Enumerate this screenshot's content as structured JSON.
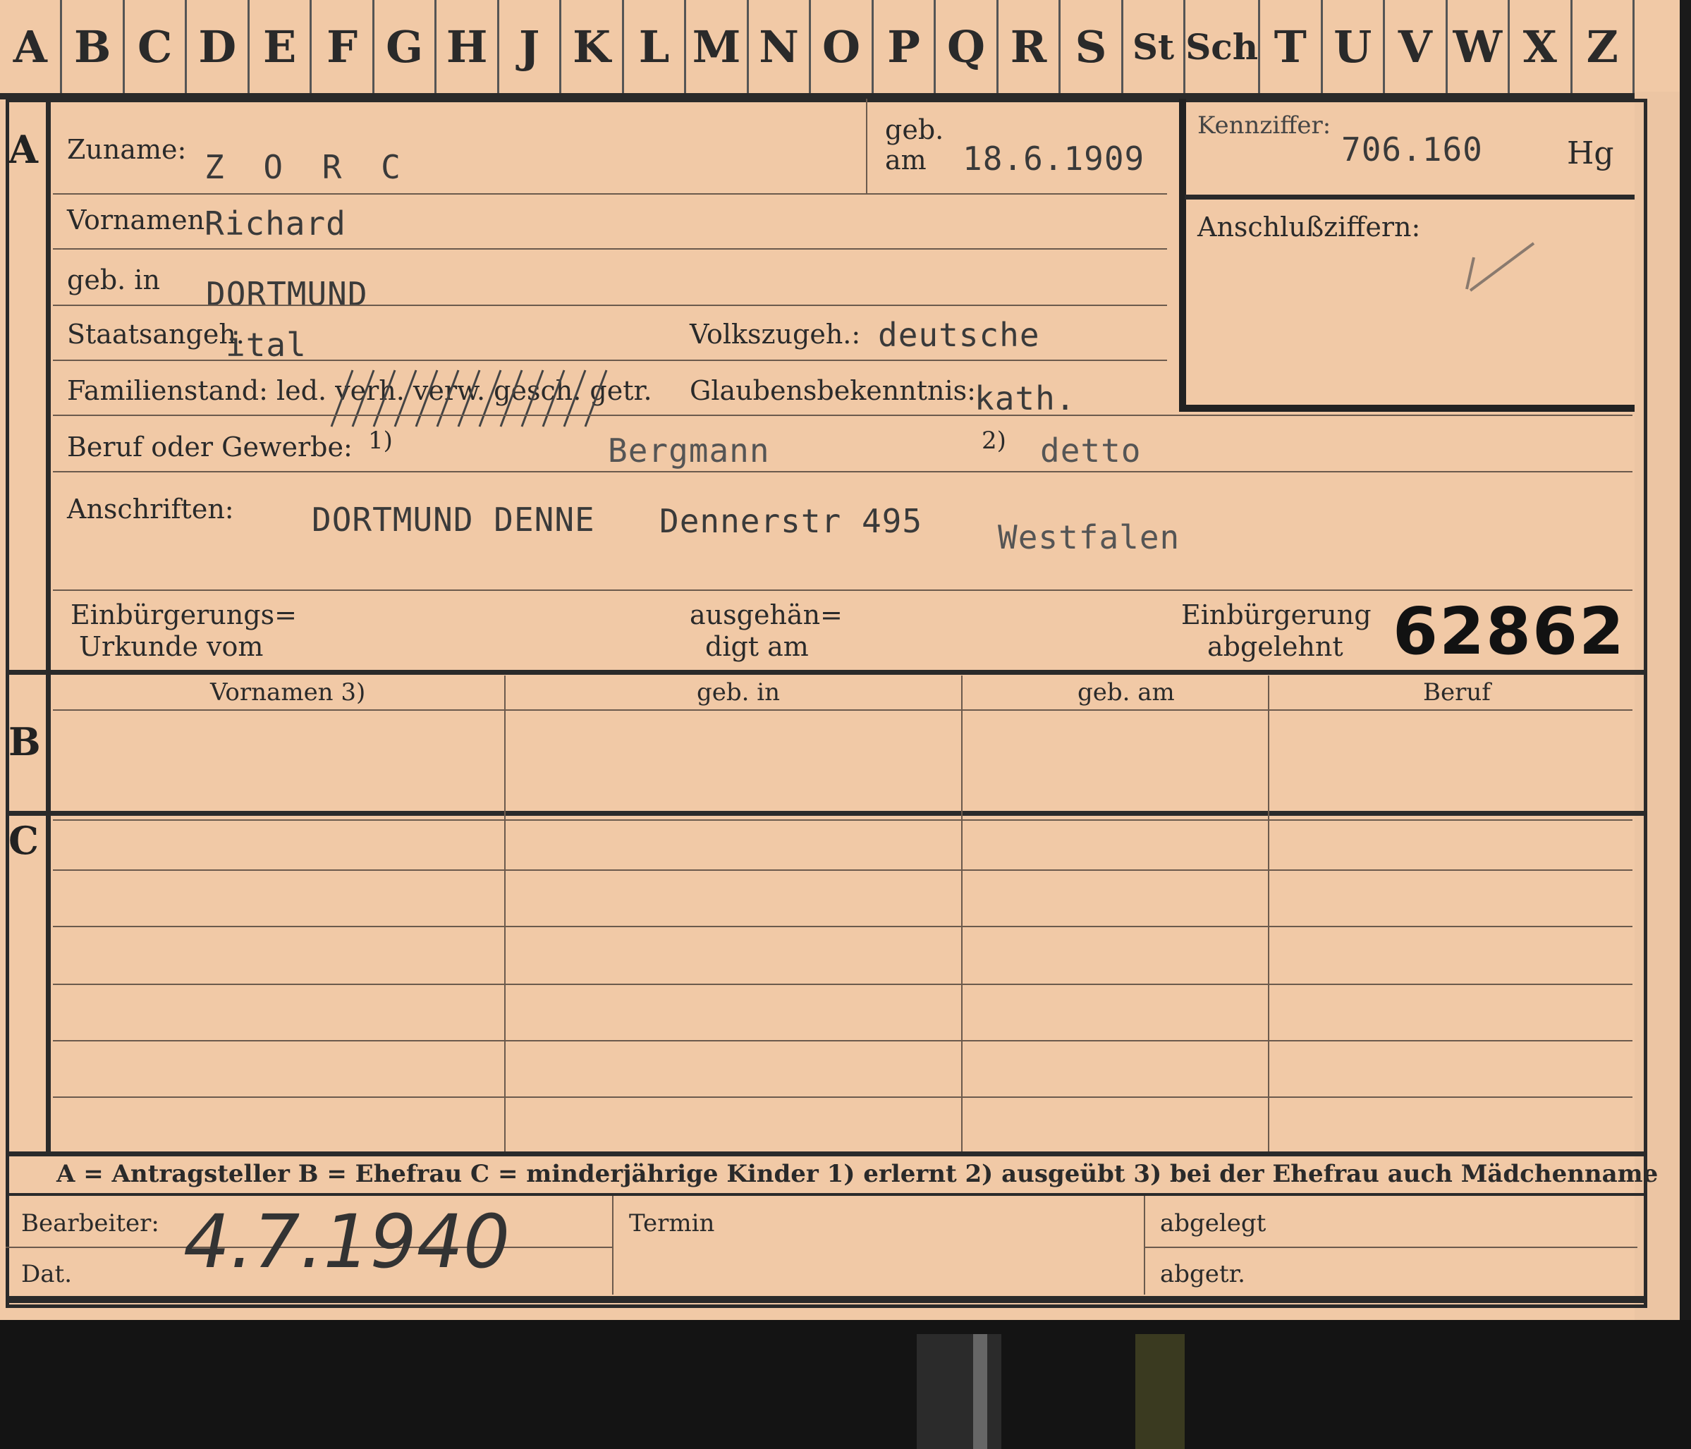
{
  "alphabet": [
    "A",
    "B",
    "C",
    "D",
    "E",
    "F",
    "G",
    "H",
    "J",
    "K",
    "L",
    "M",
    "N",
    "O",
    "P",
    "Q",
    "R",
    "S",
    "St",
    "Sch",
    "T",
    "U",
    "V",
    "W",
    "X",
    "Z"
  ],
  "section_letters": {
    "a": "A",
    "b": "B",
    "c": "C"
  },
  "labels": {
    "zuname": "Zuname:",
    "geb": "geb.",
    "am": "am",
    "vornamen": "Vornamen",
    "geb_in": "geb. in",
    "staatsangeh": "Staatsangeh.",
    "volkszugeh": "Volkszugeh.:",
    "familienstand": "Familienstand: led. verh. verw. gesch. getr.",
    "glaubensbekenntnis": "Glaubensbekenntnis:",
    "beruf": "Beruf oder Gewerbe:",
    "beruf_fn1": "1)",
    "beruf_fn2": "2)",
    "anschriften": "Anschriften:",
    "einb_urkunde_1": "Einbürgerungs=",
    "einb_urkunde_2": "Urkunde vom",
    "ausgehaendigt_1": "ausgehän=",
    "ausgehaendigt_2": "digt am",
    "einb_abgelehnt_1": "Einbürgerung",
    "einb_abgelehnt_2": "abgelehnt",
    "kennziffer": "Kennziffer:",
    "anschlussziffern": "Anschlußziffern:",
    "col_vornamen": "Vornamen 3)",
    "col_geb_in": "geb. in",
    "col_geb_am": "geb. am",
    "col_beruf": "Beruf",
    "legend": "A = Antragsteller   B = Ehefrau   C = minderjährige Kinder   1) erlernt   2) ausgeübt   3) bei der Ehefrau auch Mädchenname",
    "bearbeiter": "Bearbeiter:",
    "dat": "Dat.",
    "termin": "Termin",
    "abgelegt": "abgelegt",
    "abgetr": "abgetr."
  },
  "values": {
    "zuname": "Z O R C",
    "geb_am": "18.6.1909",
    "vornamen": "Richard",
    "geb_in": "DORTMUND",
    "staatsangeh": "ital",
    "volkszugeh": "deutsche",
    "glaubensbekenntnis": "kath.",
    "beruf_erlernt": "Bergmann",
    "beruf_ausgeuebt": "detto",
    "anschrift_1": "DORTMUND DENNE",
    "anschrift_2": "Dennerstr 495",
    "anschrift_3": "Westfalen",
    "kennziffer": "706.160",
    "kennziffer_suffix": "Hg",
    "stamp_number": "62862",
    "date_handwritten": "4.7.1940"
  }
}
